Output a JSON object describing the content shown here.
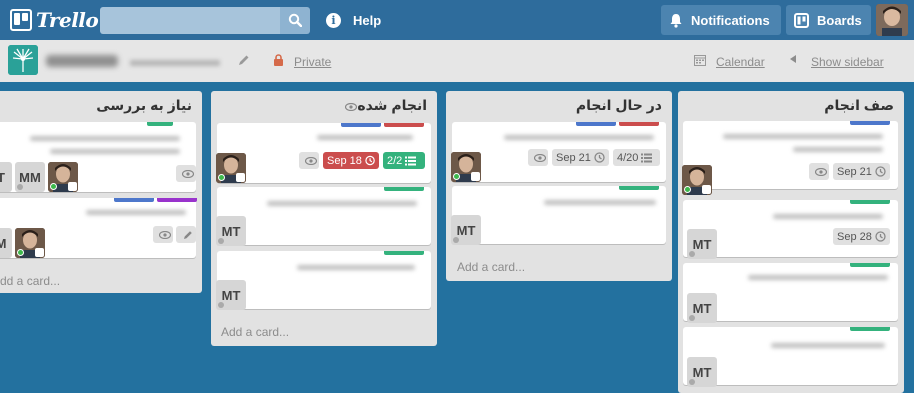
{
  "header": {
    "logo_text": "Trello",
    "search_placeholder": "",
    "help_label": "Help",
    "notifications_label": "Notifications",
    "boards_label": "Boards"
  },
  "boardbar": {
    "privacy_label": "Private",
    "calendar_label": "Calendar",
    "show_sidebar_label": "Show sidebar"
  },
  "lists": [
    {
      "title": "نیاز به بررسی",
      "add_card": "Add a card...",
      "cards": [
        {
          "members": [
            "MM"
          ]
        },
        {
          "members": []
        }
      ]
    },
    {
      "title": "انجام شده",
      "add_card": "Add a card...",
      "cards": [
        {
          "due": "Sep 18",
          "checklist": "2/2"
        },
        {
          "members": [
            "MT"
          ]
        },
        {
          "members": [
            "MT"
          ]
        }
      ]
    },
    {
      "title": "در حال انجام",
      "add_card": "Add a card...",
      "cards": [
        {
          "due": "Sep 21",
          "checklist": "4/20"
        },
        {
          "members": [
            "MT"
          ]
        }
      ]
    },
    {
      "title": "صف انجام",
      "cards": [
        {
          "due": "Sep 21"
        },
        {
          "due": "Sep 28",
          "members": [
            "MT"
          ]
        },
        {
          "members": [
            "MT"
          ]
        },
        {
          "members": [
            "MT"
          ]
        }
      ]
    }
  ],
  "colors": {
    "board_bg": "#23719f",
    "header_bg": "#2e6c9c",
    "label_blue": "#4d77cb",
    "label_red": "#cb4d4d",
    "label_green": "#34b27d",
    "label_purple": "#9933cc"
  }
}
